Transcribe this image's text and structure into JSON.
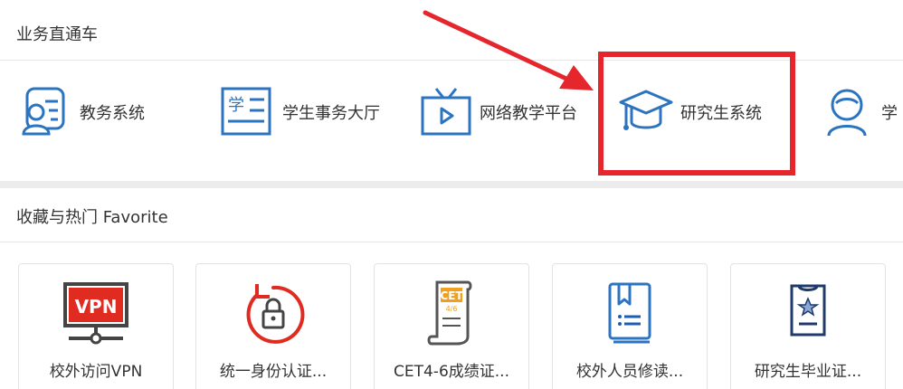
{
  "section_direct": {
    "title": "业务直通车"
  },
  "nav_items": [
    {
      "label": "教务系统",
      "icon": "academic-affairs-icon"
    },
    {
      "label": "学生事务大厅",
      "icon": "student-affairs-icon"
    },
    {
      "label": "网络教学平台",
      "icon": "online-teaching-icon"
    },
    {
      "label": "研究生系统",
      "icon": "graduate-cap-icon"
    },
    {
      "label": "学",
      "icon": "person-icon"
    }
  ],
  "section_favorite": {
    "title": "收藏与热门 Favorite"
  },
  "cards": [
    {
      "label": "校外访问VPN",
      "icon": "vpn-monitor-icon",
      "icon_text": "VPN"
    },
    {
      "label": "统一身份认证...",
      "icon": "lock-refresh-icon"
    },
    {
      "label": "CET4-6成绩证...",
      "icon": "cet-scroll-icon",
      "icon_text": "CET",
      "icon_subtext": "4/6"
    },
    {
      "label": "校外人员修读...",
      "icon": "book-icon"
    },
    {
      "label": "研究生毕业证...",
      "icon": "certificate-star-icon"
    }
  ],
  "colors": {
    "icon_blue": "#2c73c0",
    "highlight_red": "#e5262d",
    "vpn_red": "#e02b20"
  }
}
